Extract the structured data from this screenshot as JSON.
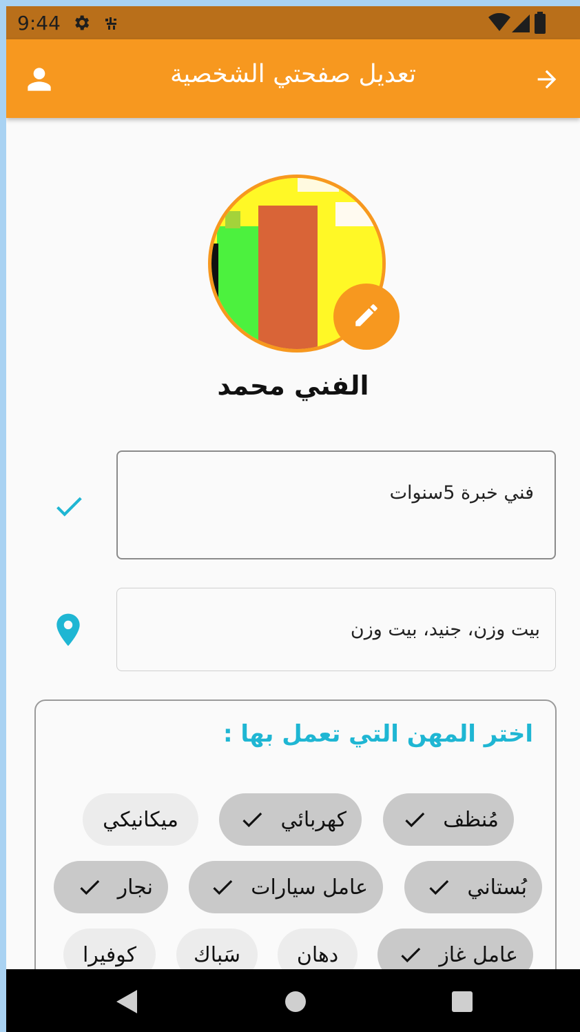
{
  "status_bar": {
    "time": "9:44",
    "icons": [
      "gear-icon",
      "app-notification-icon",
      "wifi-icon",
      "signal-icon",
      "battery-icon"
    ]
  },
  "appbar": {
    "title": "تعديل صفحتي الشخصية",
    "left_icon": "person-icon",
    "right_icon": "arrow-forward-icon",
    "color": "#f7981f"
  },
  "profile": {
    "name": "الفني محمد",
    "avatar_edit_icon": "pencil-icon"
  },
  "bio": {
    "value": "فني خبرة 5سنوات",
    "status_icon": "check-icon"
  },
  "location": {
    "value": "بيت وزن،  جنيد،  بيت وزن",
    "icon": "location-pin-icon"
  },
  "professions": {
    "title": "اختر المهن التي تعمل بها :",
    "chips": [
      {
        "label": "مُنظف",
        "selected": true
      },
      {
        "label": "كهربائي",
        "selected": true
      },
      {
        "label": "ميكانيكي",
        "selected": false
      },
      {
        "label": "بُستاني",
        "selected": true
      },
      {
        "label": "عامل سيارات",
        "selected": true
      },
      {
        "label": "نجار",
        "selected": true
      },
      {
        "label": "عامل غاز",
        "selected": true
      },
      {
        "label": "دهان",
        "selected": false
      },
      {
        "label": "سَباك",
        "selected": false
      },
      {
        "label": "كوفيرا",
        "selected": false
      }
    ]
  },
  "colors": {
    "accent": "#f7981f",
    "teal": "#1fb6d3",
    "statusbar": "#b96f1a"
  },
  "navbar": {
    "icons": [
      "back-triangle-icon",
      "home-circle-icon",
      "recents-square-icon"
    ]
  }
}
